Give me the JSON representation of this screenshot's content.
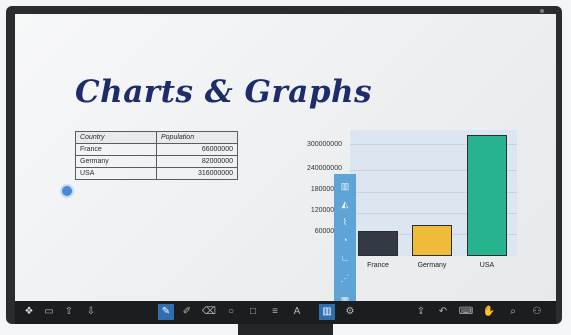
{
  "slide": {
    "heading": "Charts & Graphs",
    "table": {
      "headers": [
        "Country",
        "Population"
      ],
      "rows": [
        [
          "France",
          "66000000"
        ],
        [
          "Germany",
          "82000000"
        ],
        [
          "USA",
          "316000000"
        ]
      ]
    }
  },
  "chart_data": {
    "type": "bar",
    "categories": [
      "France",
      "Germany",
      "USA"
    ],
    "values": [
      66000000,
      82000000,
      316000000
    ],
    "colors": [
      "#333a46",
      "#f0bb3b",
      "#27b38d"
    ],
    "ylim": [
      0,
      330000000
    ],
    "yticks": [
      "300000000",
      "240000000",
      "18000000",
      "12000000",
      "6000000"
    ],
    "grid": true
  },
  "side_toolbar": {
    "icons": [
      "bar-chart-icon",
      "area-chart-icon",
      "line-chart-icon",
      "pie-chart-icon",
      "axis-icon",
      "scatter-icon",
      "table-grid-icon"
    ]
  },
  "toolbar": {
    "left_icons": [
      "app-menu-icon",
      "window-icon",
      "up-arrow-icon",
      "down-arrow-icon"
    ],
    "center_icons": [
      "pin-icon",
      "pen-icon",
      "eraser-icon",
      "circle-icon",
      "square-icon",
      "lines-icon",
      "text-icon",
      "chart-icon",
      "chart-settings-icon"
    ],
    "right_icons": [
      "export-icon",
      "undo-icon",
      "keyboard-icon",
      "hand-icon",
      "zoom-icon",
      "people-icon"
    ]
  }
}
